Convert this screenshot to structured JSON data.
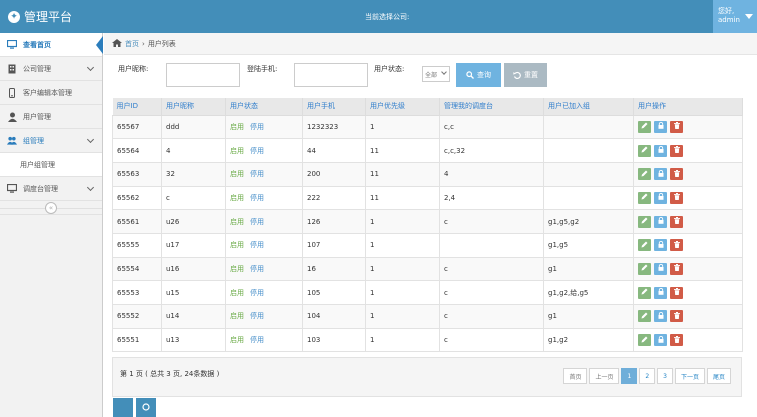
{
  "header": {
    "title": "管理平台",
    "company_label": "当前选择公司:",
    "user_hello": "您好,",
    "user_name": "admin"
  },
  "sidebar": {
    "items": [
      {
        "label": "查看首页"
      },
      {
        "label": "公司管理"
      },
      {
        "label": "客户编辑本管理"
      },
      {
        "label": "用户管理"
      },
      {
        "label": "组管理"
      },
      {
        "label": "用户组管理"
      },
      {
        "label": "调度台管理"
      }
    ]
  },
  "breadcrumb": {
    "home": "首页",
    "current": "用户列表"
  },
  "filters": {
    "nickname_label": "用户昵称:",
    "phone_label": "登陆手机:",
    "status_label": "用户状态:",
    "status_value": "全部",
    "query_label": "查询",
    "reset_label": "重置"
  },
  "table": {
    "headers": [
      "用户ID",
      "用户昵称",
      "用户状态",
      "用户手机",
      "用户优先级",
      "管理我的调度台",
      "用户已加入组",
      "用户操作"
    ],
    "status_on": "启用",
    "status_off": "停用",
    "rows": [
      {
        "id": "65567",
        "nick": "ddd",
        "phone": "1232323",
        "priority": "1",
        "console": "c,c",
        "groups": ""
      },
      {
        "id": "65564",
        "nick": "4",
        "phone": "44",
        "priority": "11",
        "console": "c,c,32",
        "groups": ""
      },
      {
        "id": "65563",
        "nick": "32",
        "phone": "200",
        "priority": "11",
        "console": "4",
        "groups": ""
      },
      {
        "id": "65562",
        "nick": "c",
        "phone": "222",
        "priority": "11",
        "console": "2,4",
        "groups": ""
      },
      {
        "id": "65561",
        "nick": "u26",
        "phone": "126",
        "priority": "1",
        "console": "c",
        "groups": "g1,g5,g2"
      },
      {
        "id": "65555",
        "nick": "u17",
        "phone": "107",
        "priority": "1",
        "console": "",
        "groups": "g1,g5"
      },
      {
        "id": "65554",
        "nick": "u16",
        "phone": "16",
        "priority": "1",
        "console": "c",
        "groups": "g1"
      },
      {
        "id": "65553",
        "nick": "u15",
        "phone": "105",
        "priority": "1",
        "console": "c",
        "groups": "g1,g2,给,g5"
      },
      {
        "id": "65552",
        "nick": "u14",
        "phone": "104",
        "priority": "1",
        "console": "c",
        "groups": "g1"
      },
      {
        "id": "65551",
        "nick": "u13",
        "phone": "103",
        "priority": "1",
        "console": "c",
        "groups": "g1,g2"
      }
    ]
  },
  "pagination": {
    "info": "第 1 页 ( 总共 3 页, 24条数据 )",
    "first": "首页",
    "prev": "上一页",
    "pages": [
      "1",
      "2",
      "3"
    ],
    "current": "1",
    "next": "下一页",
    "last": "尾页"
  },
  "colors": {
    "header": "#438eb9",
    "accent": "#2b7dbc",
    "green": "#69aa46",
    "blue": "#478fca",
    "red": "#d15b47"
  }
}
